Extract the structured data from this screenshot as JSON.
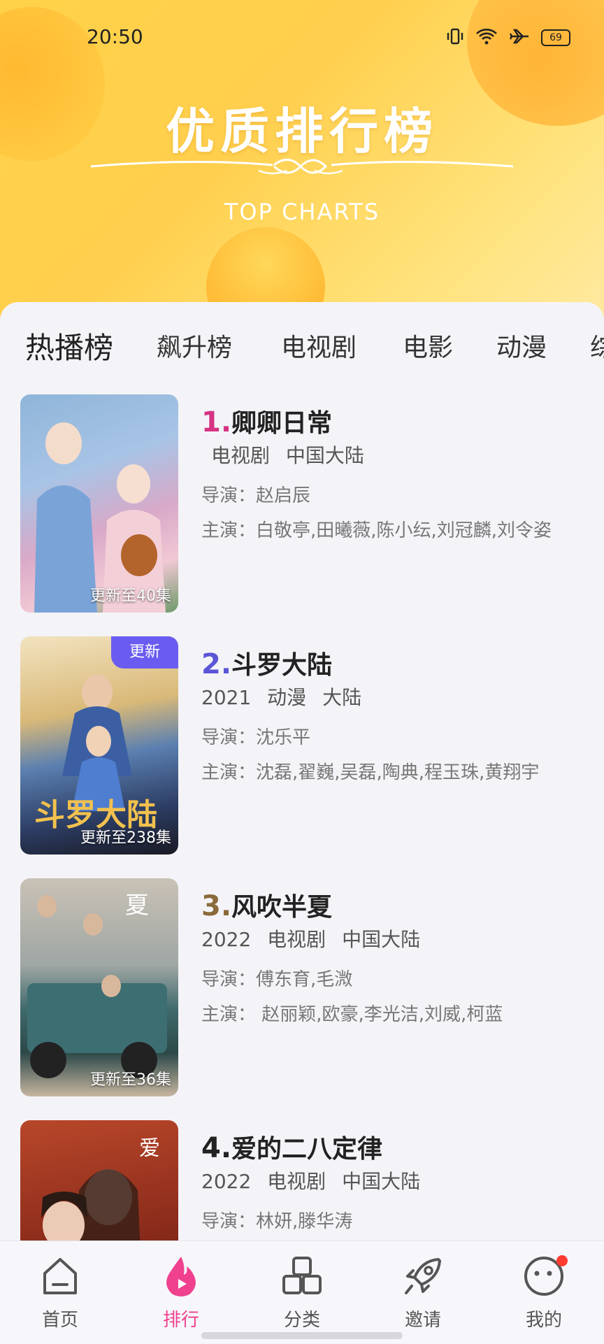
{
  "status_bar": {
    "time": "20:50",
    "battery": "69"
  },
  "header": {
    "title": "优质排行榜",
    "subtitle": "TOP CHARTS"
  },
  "tabs": [
    {
      "label": "热播榜"
    },
    {
      "label": "飙升榜"
    },
    {
      "label": "电视剧"
    },
    {
      "label": "电影"
    },
    {
      "label": "动漫"
    },
    {
      "label": "综"
    }
  ],
  "rank_colors": {
    "1": "#d63384",
    "2": "#5b56d6",
    "3": "#8a6a3a",
    "4": "#222222"
  },
  "items": [
    {
      "rank": "1.",
      "title": "卿卿日常",
      "year": "",
      "category": "电视剧",
      "region": "中国大陆",
      "director": "导演：赵启辰",
      "cast": "主演：白敬亭,田曦薇,陈小纭,刘冠麟,刘令姿",
      "episodes": "更新至40集",
      "badge": ""
    },
    {
      "rank": "2.",
      "title": "斗罗大陆",
      "year": "2021",
      "category": "动漫",
      "region": "大陆",
      "director": "导演：沈乐平",
      "cast": "主演：沈磊,翟巍,吴磊,陶典,程玉珠,黄翔宇",
      "episodes": "更新至238集",
      "badge": "更新"
    },
    {
      "rank": "3.",
      "title": "风吹半夏",
      "year": "2022",
      "category": "电视剧",
      "region": "中国大陆",
      "director": "导演：傅东育,毛溦",
      "cast": "主演： 赵丽颖,欧豪,李光洁,刘威,柯蓝",
      "episodes": "更新至36集",
      "badge": ""
    },
    {
      "rank": "4.",
      "title": "爱的二八定律",
      "year": "2022",
      "category": "电视剧",
      "region": "中国大陆",
      "director": "导演：林妍,滕华涛",
      "cast": "",
      "episodes": "",
      "badge": ""
    }
  ],
  "nav": [
    {
      "label": "首页",
      "icon": "home-icon"
    },
    {
      "label": "排行",
      "icon": "flame-play-icon"
    },
    {
      "label": "分类",
      "icon": "grid-icon"
    },
    {
      "label": "邀请",
      "icon": "rocket-icon"
    },
    {
      "label": "我的",
      "icon": "face-icon"
    }
  ],
  "colors": {
    "accent": "#f0418f",
    "badge": "#6a5cf0",
    "header": "#ffd24a"
  }
}
